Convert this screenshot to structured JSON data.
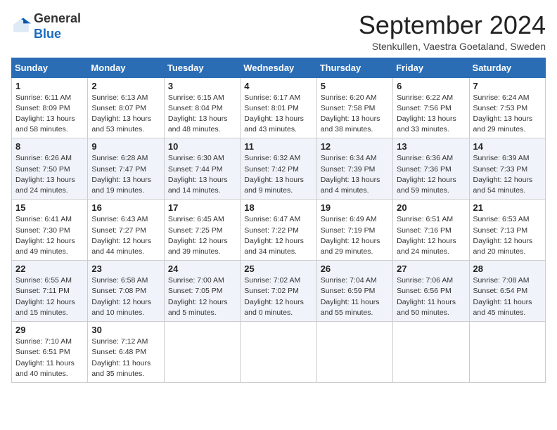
{
  "header": {
    "logo_general": "General",
    "logo_blue": "Blue",
    "title": "September 2024",
    "subtitle": "Stenkullen, Vaestra Goetaland, Sweden"
  },
  "days_of_week": [
    "Sunday",
    "Monday",
    "Tuesday",
    "Wednesday",
    "Thursday",
    "Friday",
    "Saturday"
  ],
  "weeks": [
    [
      {
        "day": "1",
        "sunrise": "6:11 AM",
        "sunset": "8:09 PM",
        "daylight": "13 hours and 58 minutes."
      },
      {
        "day": "2",
        "sunrise": "6:13 AM",
        "sunset": "8:07 PM",
        "daylight": "13 hours and 53 minutes."
      },
      {
        "day": "3",
        "sunrise": "6:15 AM",
        "sunset": "8:04 PM",
        "daylight": "13 hours and 48 minutes."
      },
      {
        "day": "4",
        "sunrise": "6:17 AM",
        "sunset": "8:01 PM",
        "daylight": "13 hours and 43 minutes."
      },
      {
        "day": "5",
        "sunrise": "6:20 AM",
        "sunset": "7:58 PM",
        "daylight": "13 hours and 38 minutes."
      },
      {
        "day": "6",
        "sunrise": "6:22 AM",
        "sunset": "7:56 PM",
        "daylight": "13 hours and 33 minutes."
      },
      {
        "day": "7",
        "sunrise": "6:24 AM",
        "sunset": "7:53 PM",
        "daylight": "13 hours and 29 minutes."
      }
    ],
    [
      {
        "day": "8",
        "sunrise": "6:26 AM",
        "sunset": "7:50 PM",
        "daylight": "13 hours and 24 minutes."
      },
      {
        "day": "9",
        "sunrise": "6:28 AM",
        "sunset": "7:47 PM",
        "daylight": "13 hours and 19 minutes."
      },
      {
        "day": "10",
        "sunrise": "6:30 AM",
        "sunset": "7:44 PM",
        "daylight": "13 hours and 14 minutes."
      },
      {
        "day": "11",
        "sunrise": "6:32 AM",
        "sunset": "7:42 PM",
        "daylight": "13 hours and 9 minutes."
      },
      {
        "day": "12",
        "sunrise": "6:34 AM",
        "sunset": "7:39 PM",
        "daylight": "13 hours and 4 minutes."
      },
      {
        "day": "13",
        "sunrise": "6:36 AM",
        "sunset": "7:36 PM",
        "daylight": "12 hours and 59 minutes."
      },
      {
        "day": "14",
        "sunrise": "6:39 AM",
        "sunset": "7:33 PM",
        "daylight": "12 hours and 54 minutes."
      }
    ],
    [
      {
        "day": "15",
        "sunrise": "6:41 AM",
        "sunset": "7:30 PM",
        "daylight": "12 hours and 49 minutes."
      },
      {
        "day": "16",
        "sunrise": "6:43 AM",
        "sunset": "7:27 PM",
        "daylight": "12 hours and 44 minutes."
      },
      {
        "day": "17",
        "sunrise": "6:45 AM",
        "sunset": "7:25 PM",
        "daylight": "12 hours and 39 minutes."
      },
      {
        "day": "18",
        "sunrise": "6:47 AM",
        "sunset": "7:22 PM",
        "daylight": "12 hours and 34 minutes."
      },
      {
        "day": "19",
        "sunrise": "6:49 AM",
        "sunset": "7:19 PM",
        "daylight": "12 hours and 29 minutes."
      },
      {
        "day": "20",
        "sunrise": "6:51 AM",
        "sunset": "7:16 PM",
        "daylight": "12 hours and 24 minutes."
      },
      {
        "day": "21",
        "sunrise": "6:53 AM",
        "sunset": "7:13 PM",
        "daylight": "12 hours and 20 minutes."
      }
    ],
    [
      {
        "day": "22",
        "sunrise": "6:55 AM",
        "sunset": "7:11 PM",
        "daylight": "12 hours and 15 minutes."
      },
      {
        "day": "23",
        "sunrise": "6:58 AM",
        "sunset": "7:08 PM",
        "daylight": "12 hours and 10 minutes."
      },
      {
        "day": "24",
        "sunrise": "7:00 AM",
        "sunset": "7:05 PM",
        "daylight": "12 hours and 5 minutes."
      },
      {
        "day": "25",
        "sunrise": "7:02 AM",
        "sunset": "7:02 PM",
        "daylight": "12 hours and 0 minutes."
      },
      {
        "day": "26",
        "sunrise": "7:04 AM",
        "sunset": "6:59 PM",
        "daylight": "11 hours and 55 minutes."
      },
      {
        "day": "27",
        "sunrise": "7:06 AM",
        "sunset": "6:56 PM",
        "daylight": "11 hours and 50 minutes."
      },
      {
        "day": "28",
        "sunrise": "7:08 AM",
        "sunset": "6:54 PM",
        "daylight": "11 hours and 45 minutes."
      }
    ],
    [
      {
        "day": "29",
        "sunrise": "7:10 AM",
        "sunset": "6:51 PM",
        "daylight": "11 hours and 40 minutes."
      },
      {
        "day": "30",
        "sunrise": "7:12 AM",
        "sunset": "6:48 PM",
        "daylight": "11 hours and 35 minutes."
      },
      null,
      null,
      null,
      null,
      null
    ]
  ]
}
